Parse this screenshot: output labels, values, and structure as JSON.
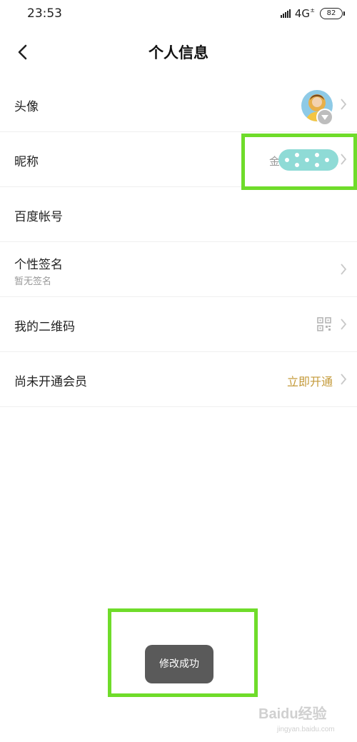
{
  "status_bar": {
    "time": "23:53",
    "network": "4G",
    "battery": "82"
  },
  "header": {
    "title": "个人信息"
  },
  "rows": [
    {
      "label": "头像"
    },
    {
      "label": "昵称",
      "value_prefix": "金"
    },
    {
      "label": "百度帐号"
    },
    {
      "label": "个性签名",
      "sub": "暂无签名"
    },
    {
      "label": "我的二维码"
    },
    {
      "label": "尚未开通会员",
      "action": "立即开通"
    }
  ],
  "toast": {
    "message": "修改成功"
  },
  "watermark": {
    "logo_text": "Baidu经验",
    "url": "jingyan.baidu.com"
  },
  "colors": {
    "accent": "#c49a3a",
    "highlight": "#6fdc2a",
    "toast_bg": "#5a5a5a",
    "divider": "#efefef"
  }
}
